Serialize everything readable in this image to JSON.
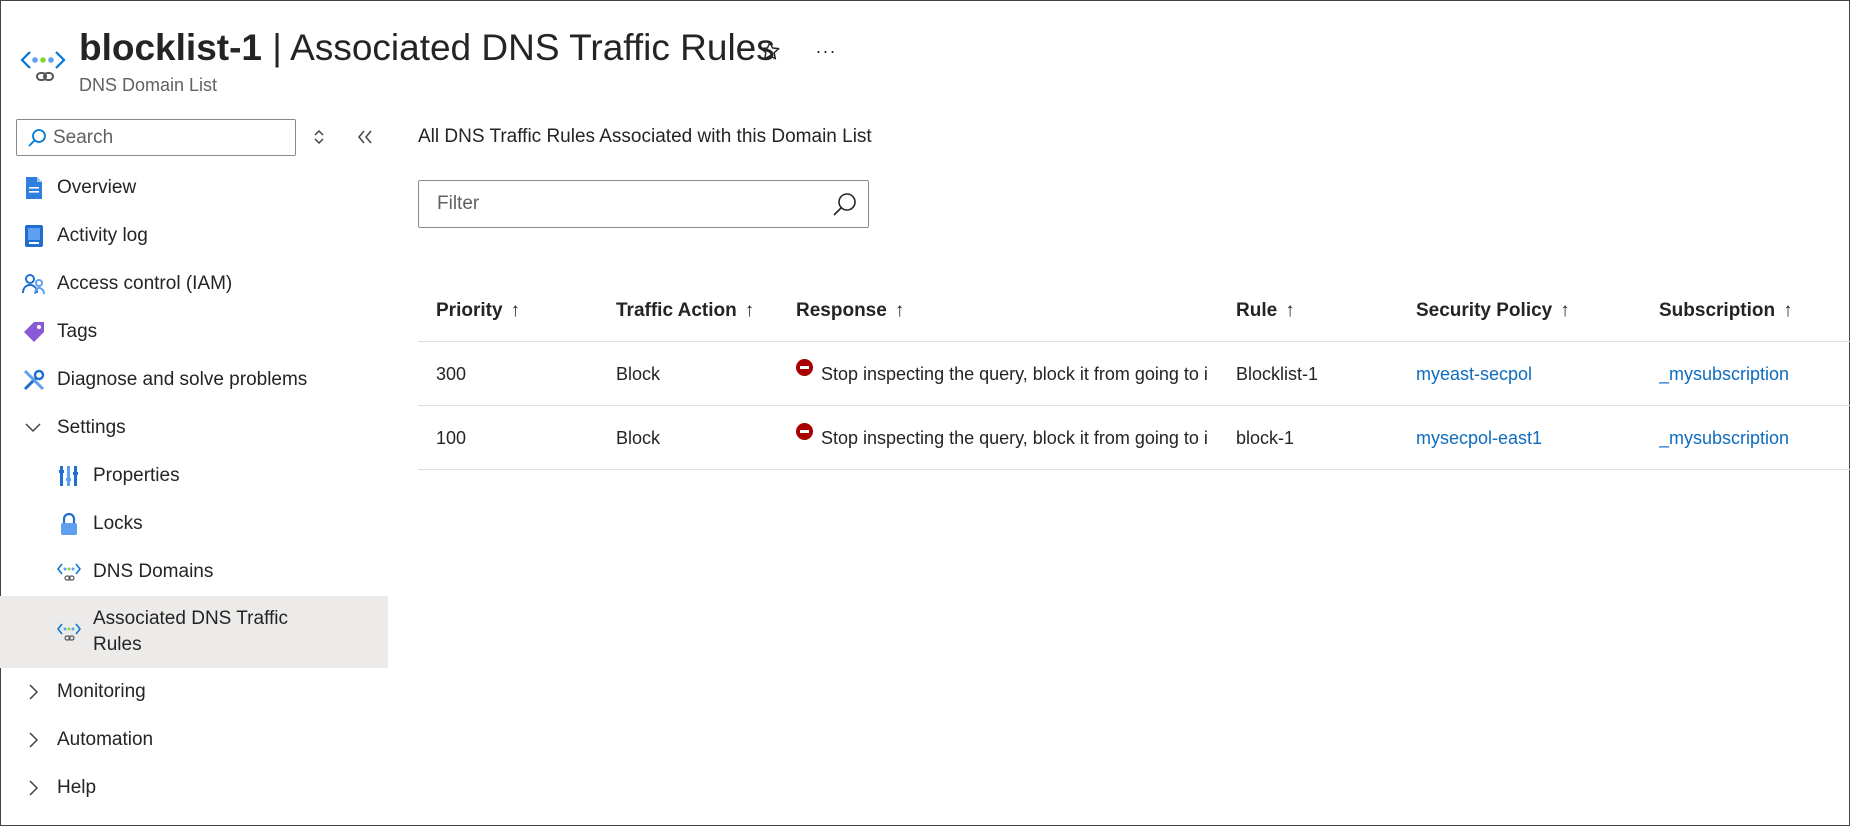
{
  "header": {
    "resource_name": "blocklist-1",
    "separator": " | ",
    "page_title": "Associated DNS Traffic Rules",
    "subtitle": "DNS Domain List",
    "favorite_icon": "star-icon",
    "more_label": "···"
  },
  "sidebar": {
    "search_placeholder": "Search",
    "collapse_label": "«",
    "updown_label": "◇",
    "items": [
      {
        "label": "Overview",
        "icon": "overview-icon"
      },
      {
        "label": "Activity log",
        "icon": "activity-log-icon"
      },
      {
        "label": "Access control (IAM)",
        "icon": "iam-icon"
      },
      {
        "label": "Tags",
        "icon": "tag-icon"
      },
      {
        "label": "Diagnose and solve problems",
        "icon": "wrench-icon"
      },
      {
        "label": "Settings",
        "icon": "chevron-down-icon"
      },
      {
        "label": "Properties",
        "icon": "properties-icon"
      },
      {
        "label": "Locks",
        "icon": "lock-icon"
      },
      {
        "label": "DNS Domains",
        "icon": "dns-domain-list-icon"
      },
      {
        "label": "Associated DNS Traffic Rules",
        "icon": "dns-domain-list-icon"
      },
      {
        "label": "Monitoring",
        "icon": "chevron-right-icon"
      },
      {
        "label": "Automation",
        "icon": "chevron-right-icon"
      },
      {
        "label": "Help",
        "icon": "chevron-right-icon"
      }
    ]
  },
  "main": {
    "section_title": "All DNS Traffic Rules Associated with this Domain List",
    "filter_placeholder": "Filter",
    "columns": [
      {
        "label": "Priority",
        "sort": "↑"
      },
      {
        "label": "Traffic Action",
        "sort": "↑"
      },
      {
        "label": "Response",
        "sort": "↑"
      },
      {
        "label": "Rule",
        "sort": "↑"
      },
      {
        "label": "Security Policy",
        "sort": "↑"
      },
      {
        "label": "Subscription",
        "sort": "↑"
      }
    ],
    "rows": [
      {
        "priority": "300",
        "action": "Block",
        "response": "Stop inspecting the query, block it from going to i",
        "rule": "Blocklist-1",
        "policy": "myeast-secpol",
        "subscription": "_mysubscription"
      },
      {
        "priority": "100",
        "action": "Block",
        "response": "Stop inspecting the query, block it from going to i",
        "rule": "block-1",
        "policy": "mysecpol-east1",
        "subscription": "_mysubscription"
      }
    ]
  },
  "colors": {
    "link": "#0f6cbd",
    "selected_bg": "#edebe9",
    "block_icon": "#a80000"
  }
}
